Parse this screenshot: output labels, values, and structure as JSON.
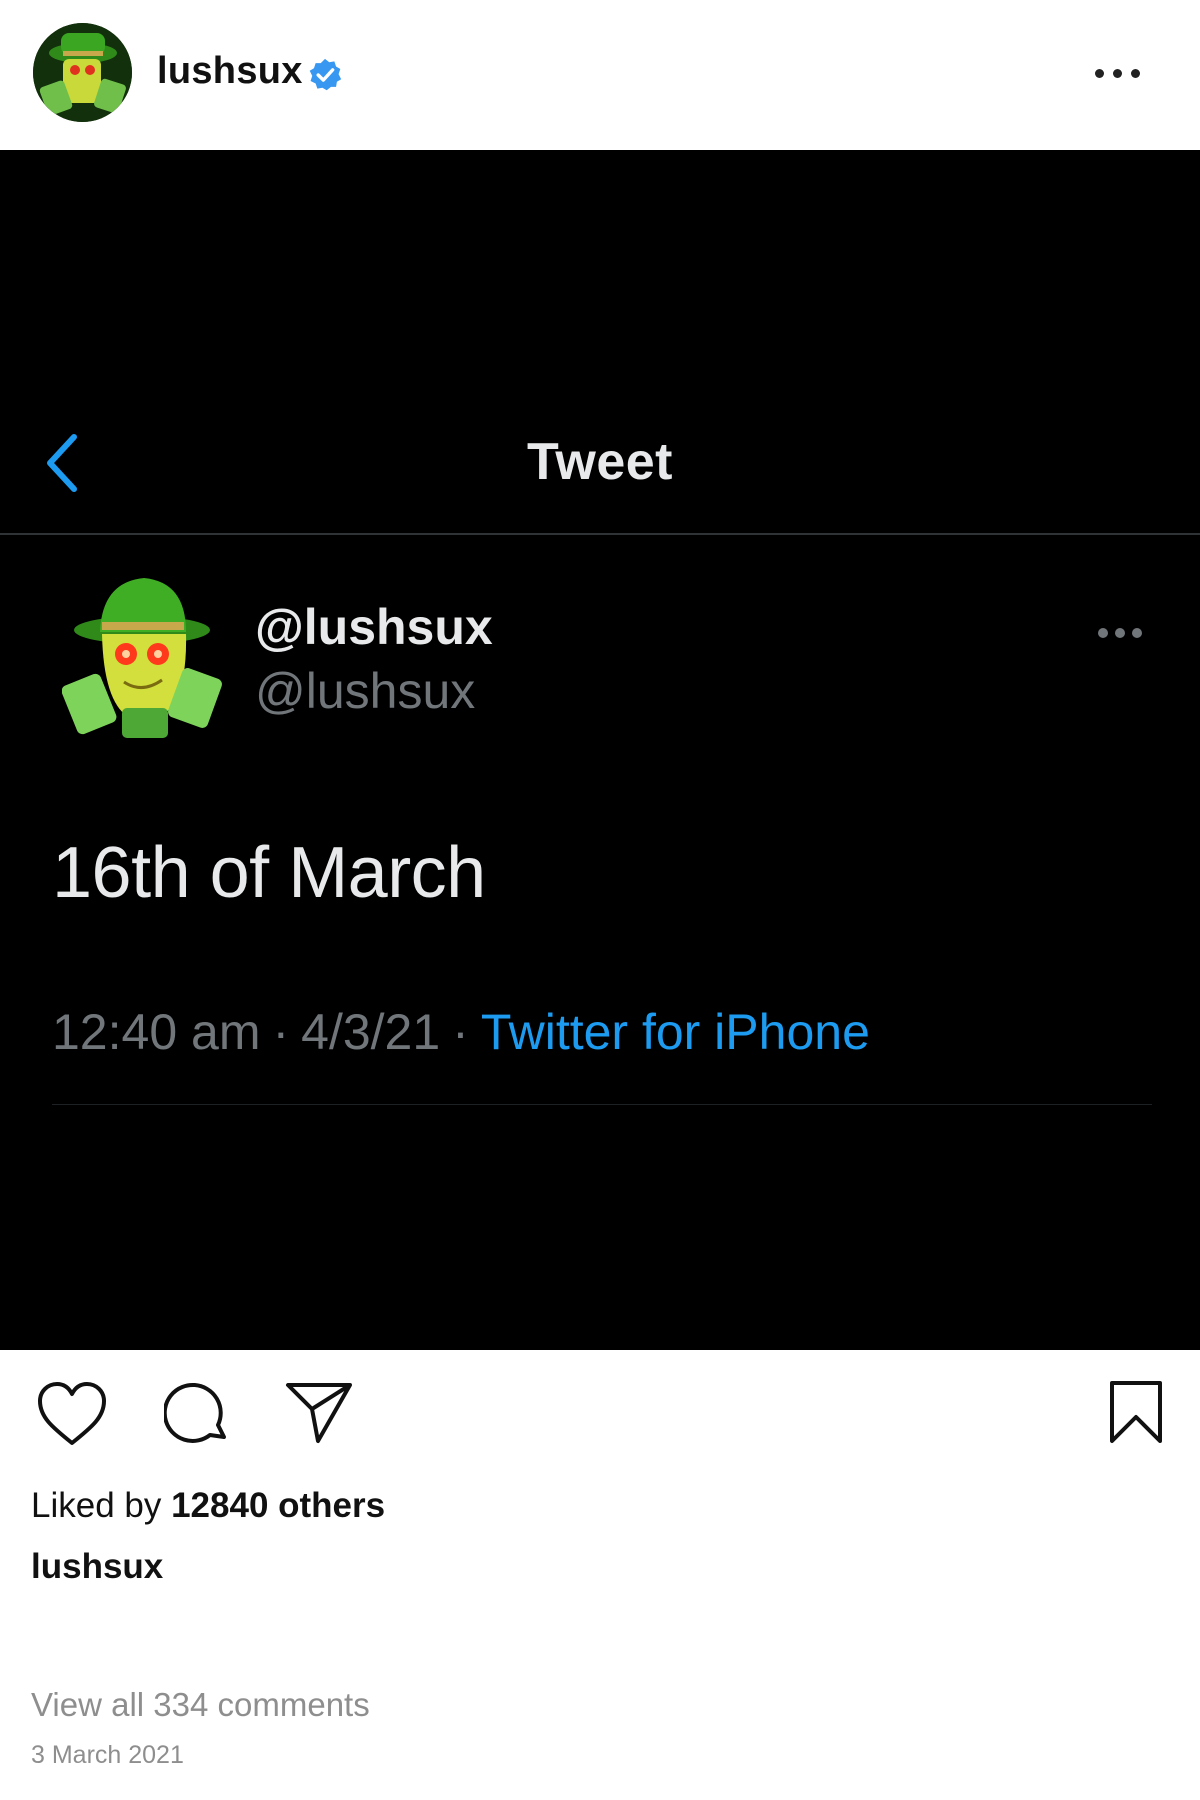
{
  "header": {
    "username": "lushsux",
    "verified": true,
    "more_icon": "more-horizontal-icon"
  },
  "tweet": {
    "nav_title": "Tweet",
    "display_name": "@lushsux",
    "handle": "@lushsux",
    "text": "16th of March",
    "time": "12:40 am",
    "date": "4/3/21",
    "separator": "·",
    "source": "Twitter for iPhone",
    "colors": {
      "background": "#000000",
      "link": "#1d9bf0",
      "muted": "#71767b",
      "text": "#e7e9ea"
    }
  },
  "actions": {
    "icons": [
      "heart-icon",
      "comment-icon",
      "share-icon",
      "bookmark-icon"
    ]
  },
  "likes": {
    "prefix": "Liked by ",
    "count_text": "12840 others"
  },
  "caption": {
    "username": "lushsux"
  },
  "comments": {
    "view_all": "View all 334 comments"
  },
  "post_date": "3 March 2021",
  "colors": {
    "verified": "#3897f0",
    "muted": "#8e8e8e"
  }
}
